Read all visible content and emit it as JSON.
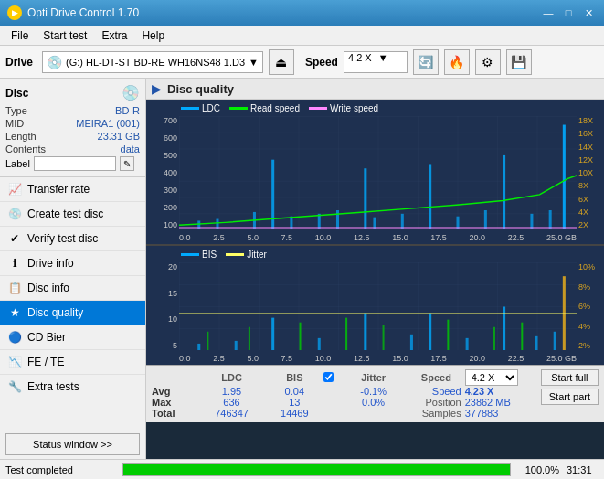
{
  "titleBar": {
    "title": "Opti Drive Control 1.70",
    "minimize": "—",
    "maximize": "□",
    "close": "✕"
  },
  "menuBar": {
    "items": [
      "File",
      "Start test",
      "Extra",
      "Help"
    ]
  },
  "toolbar": {
    "driveLabel": "Drive",
    "driveValue": "(G:)  HL-DT-ST BD-RE  WH16NS48 1.D3",
    "speedLabel": "Speed",
    "speedValue": "4.2 X"
  },
  "disc": {
    "title": "Disc",
    "typeLabel": "Type",
    "typeValue": "BD-R",
    "midLabel": "MID",
    "midValue": "MEIRA1 (001)",
    "lengthLabel": "Length",
    "lengthValue": "23.31 GB",
    "contentsLabel": "Contents",
    "contentsValue": "data",
    "labelLabel": "Label"
  },
  "navItems": [
    {
      "id": "transfer-rate",
      "label": "Transfer rate",
      "icon": "📈"
    },
    {
      "id": "create-test-disc",
      "label": "Create test disc",
      "icon": "💿"
    },
    {
      "id": "verify-test-disc",
      "label": "Verify test disc",
      "icon": "✔"
    },
    {
      "id": "drive-info",
      "label": "Drive info",
      "icon": "ℹ"
    },
    {
      "id": "disc-info",
      "label": "Disc info",
      "icon": "📋"
    },
    {
      "id": "disc-quality",
      "label": "Disc quality",
      "icon": "★",
      "active": true
    },
    {
      "id": "cd-bier",
      "label": "CD Bier",
      "icon": "🔵"
    },
    {
      "id": "fe-te",
      "label": "FE / TE",
      "icon": "📉"
    },
    {
      "id": "extra-tests",
      "label": "Extra tests",
      "icon": "🔧"
    }
  ],
  "statusWindowBtn": "Status window >>",
  "chartHeader": "Disc quality",
  "upperChart": {
    "legend": [
      {
        "label": "LDC",
        "color": "#00aaff"
      },
      {
        "label": "Read speed",
        "color": "#00ee00"
      },
      {
        "label": "Write speed",
        "color": "#ff00ff"
      }
    ],
    "yLabels": [
      "700",
      "600",
      "500",
      "400",
      "300",
      "200",
      "100"
    ],
    "rightYLabels": [
      "18X",
      "16X",
      "14X",
      "12X",
      "10X",
      "8X",
      "6X",
      "4X",
      "2X"
    ],
    "xLabels": [
      "0.0",
      "2.5",
      "5.0",
      "7.5",
      "10.0",
      "12.5",
      "15.0",
      "17.5",
      "20.0",
      "22.5",
      "25.0 GB"
    ]
  },
  "lowerChart": {
    "legend": [
      {
        "label": "BIS",
        "color": "#00aaff"
      },
      {
        "label": "Jitter",
        "color": "#ffff00"
      }
    ],
    "yLabels": [
      "20",
      "15",
      "10",
      "5"
    ],
    "rightYLabels": [
      "10%",
      "8%",
      "6%",
      "4%",
      "2%"
    ],
    "xLabels": [
      "0.0",
      "2.5",
      "5.0",
      "7.5",
      "10.0",
      "12.5",
      "15.0",
      "17.5",
      "20.0",
      "22.5",
      "25.0 GB"
    ]
  },
  "stats": {
    "headers": [
      "",
      "LDC",
      "BIS",
      "",
      "Jitter",
      "Speed",
      ""
    ],
    "avgLabel": "Avg",
    "avgLDC": "1.95",
    "avgBIS": "0.04",
    "avgJitter": "-0.1%",
    "maxLabel": "Max",
    "maxLDC": "636",
    "maxBIS": "13",
    "maxJitter": "0.0%",
    "totalLabel": "Total",
    "totalLDC": "746347",
    "totalBIS": "14469",
    "speedLabel": "Speed",
    "speedValue": "4.23 X",
    "speedSelect": "4.2 X",
    "positionLabel": "Position",
    "positionValue": "23862 MB",
    "samplesLabel": "Samples",
    "samplesValue": "377883",
    "startFullBtn": "Start full",
    "startPartBtn": "Start part",
    "jitterLabel": "Jitter",
    "jitterChecked": true
  },
  "statusBar": {
    "text": "Test completed",
    "progress": 100,
    "progressLabel": "100.0%",
    "time": "31:31"
  }
}
